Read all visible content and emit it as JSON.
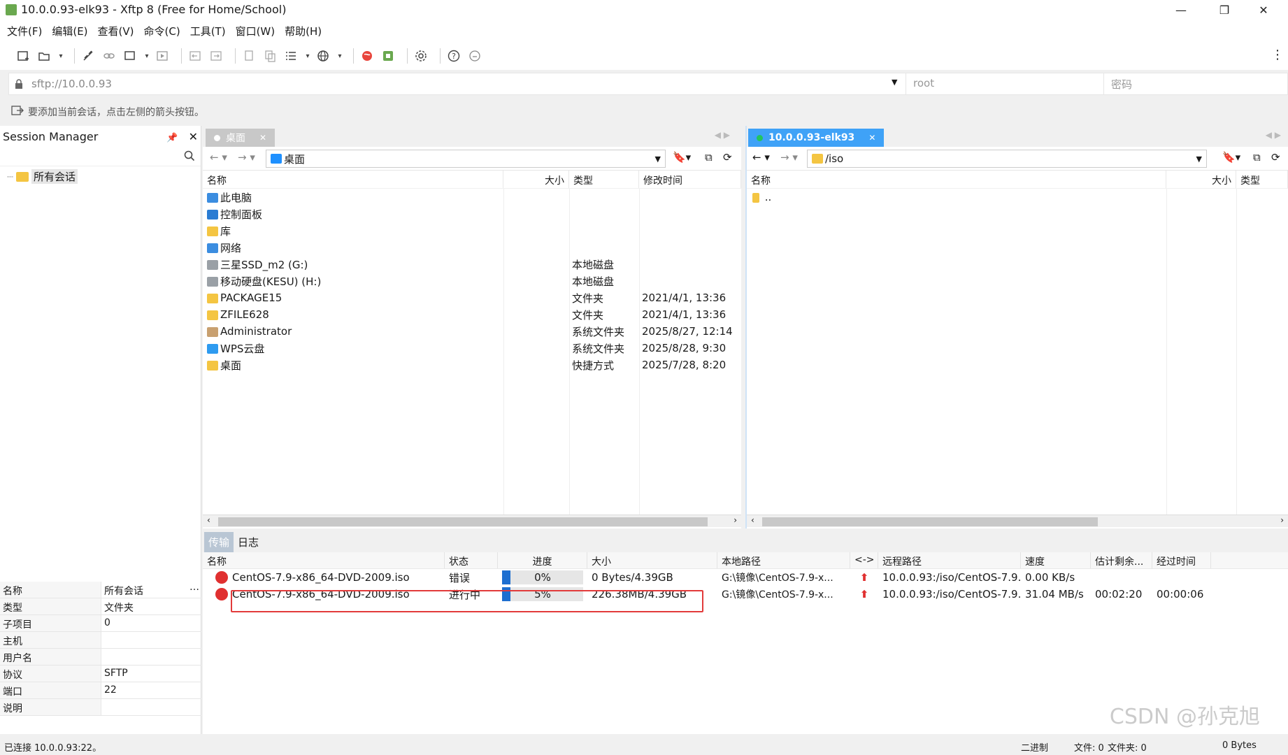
{
  "window": {
    "title": "10.0.0.93-elk93 - Xftp 8 (Free for Home/School)",
    "minimize": "—",
    "maximize": "❐",
    "close": "✕"
  },
  "menu": [
    "文件(F)",
    "编辑(E)",
    "查看(V)",
    "命令(C)",
    "工具(T)",
    "窗口(W)",
    "帮助(H)"
  ],
  "address": {
    "url": "sftp://10.0.0.93",
    "user_placeholder": "root",
    "password_placeholder": "密码"
  },
  "hint": "要添加当前会话，点击左侧的箭头按钮。",
  "session": {
    "title": "Session Manager",
    "tree_root": "所有会话",
    "properties": [
      {
        "k": "名称",
        "v": "所有会话"
      },
      {
        "k": "类型",
        "v": "文件夹"
      },
      {
        "k": "子项目",
        "v": "0"
      },
      {
        "k": "主机",
        "v": ""
      },
      {
        "k": "用户名",
        "v": ""
      },
      {
        "k": "协议",
        "v": "SFTP"
      },
      {
        "k": "端口",
        "v": "22"
      },
      {
        "k": "说明",
        "v": ""
      }
    ]
  },
  "local": {
    "tab": "桌面",
    "path": "桌面",
    "columns": {
      "name": "名称",
      "size": "大小",
      "type": "类型",
      "mtime": "修改时间"
    },
    "rows": [
      {
        "name": "此电脑",
        "type": "",
        "mtime": "",
        "icon": "pc"
      },
      {
        "name": "控制面板",
        "type": "",
        "mtime": "",
        "icon": "panel"
      },
      {
        "name": "库",
        "type": "",
        "mtime": "",
        "icon": "lib"
      },
      {
        "name": "网络",
        "type": "",
        "mtime": "",
        "icon": "net"
      },
      {
        "name": "三星SSD_m2 (G:)",
        "type": "本地磁盘",
        "mtime": "",
        "icon": "disk"
      },
      {
        "name": "移动硬盘(KESU) (H:)",
        "type": "本地磁盘",
        "mtime": "",
        "icon": "disk"
      },
      {
        "name": "PACKAGE15",
        "type": "文件夹",
        "mtime": "2021/4/1, 13:36",
        "icon": "folder"
      },
      {
        "name": "ZFILE628",
        "type": "文件夹",
        "mtime": "2021/4/1, 13:36",
        "icon": "folder"
      },
      {
        "name": "Administrator",
        "type": "系统文件夹",
        "mtime": "2025/8/27, 12:14",
        "icon": "user"
      },
      {
        "name": "WPS云盘",
        "type": "系统文件夹",
        "mtime": "2025/8/28, 9:30",
        "icon": "cloud"
      },
      {
        "name": "桌面",
        "type": "快捷方式",
        "mtime": "2025/7/28, 8:20",
        "icon": "shortcut"
      }
    ]
  },
  "remote": {
    "tab": "10.0.0.93-elk93",
    "path": "/iso",
    "columns": {
      "name": "名称",
      "size": "大小",
      "type": "类型"
    },
    "rows": [
      {
        "name": ".."
      }
    ]
  },
  "transfer": {
    "tabs": [
      "传输",
      "日志"
    ],
    "columns": [
      "名称",
      "状态",
      "进度",
      "大小",
      "本地路径",
      "<->",
      "远程路径",
      "速度",
      "估计剩余...",
      "经过时间"
    ],
    "rows": [
      {
        "name": "CentOS-7.9-x86_64-DVD-2009.iso",
        "status": "错误",
        "progress": "0%",
        "progress_value": 0,
        "size": "0 Bytes/4.39GB",
        "local": "G:\\镜像\\CentOS-7.9-x...",
        "remote": "10.0.0.93:/iso/CentOS-7.9...",
        "speed": "0.00 KB/s",
        "eta": "",
        "elapsed": ""
      },
      {
        "name": "CentOS-7.9-x86_64-DVD-2009.iso",
        "status": "进行中",
        "progress": "5%",
        "progress_value": 5,
        "size": "226.38MB/4.39GB",
        "local": "G:\\镜像\\CentOS-7.9-x...",
        "remote": "10.0.0.93:/iso/CentOS-7.9...",
        "speed": "31.04 MB/s",
        "eta": "00:02:20",
        "elapsed": "00:00:06"
      }
    ]
  },
  "status": {
    "left": "已连接 10.0.0.93:22。",
    "mode": "二进制",
    "files": "文件: 0",
    "folders": "文件夹: 0",
    "bytes": "0 Bytes"
  },
  "watermark": "CSDN @孙克旭",
  "colors": {
    "accent": "#3fa2f7",
    "error": "#e03030",
    "highlight_box": "#e23b3b"
  }
}
